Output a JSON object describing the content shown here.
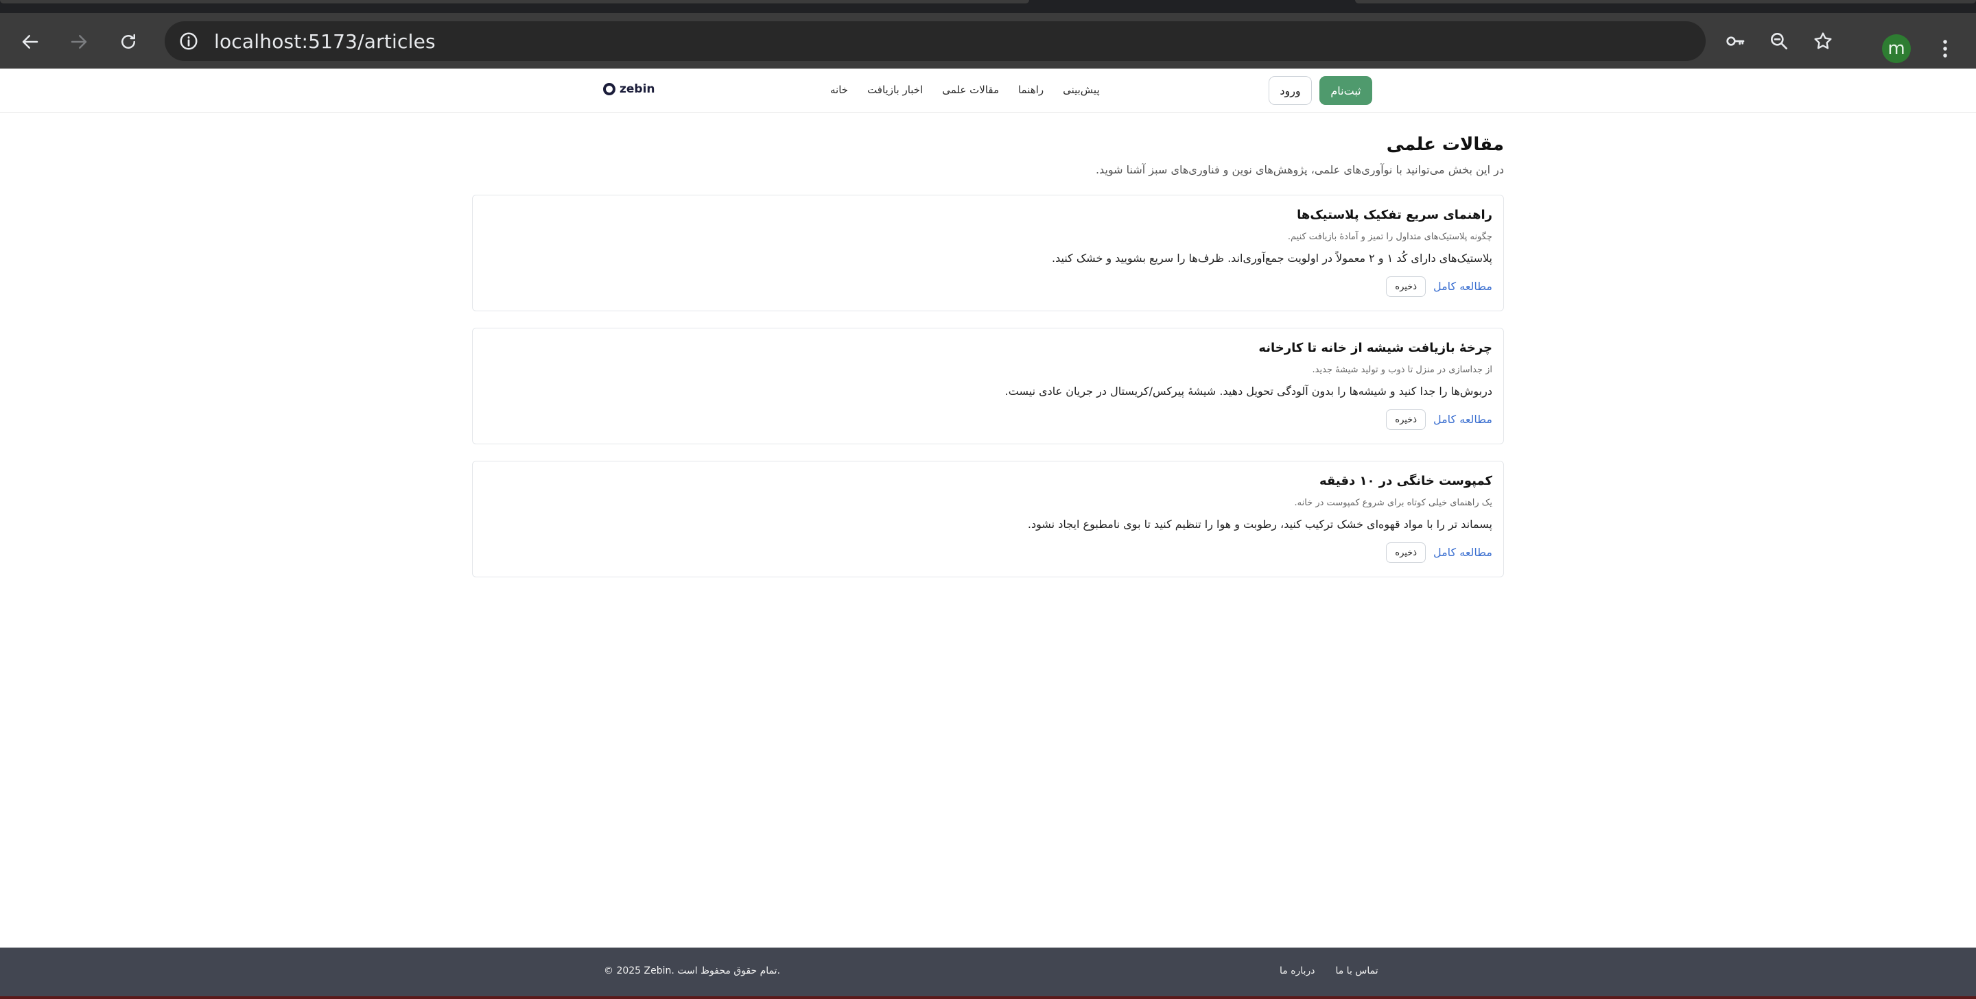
{
  "browser": {
    "url": "localhost:5173/articles",
    "icons": [
      "back-arrow-icon",
      "forward-arrow-icon",
      "reload-icon",
      "info-icon",
      "password-key-icon",
      "zoom-icon",
      "bookmark-star-icon",
      "menu-kebab-icon"
    ],
    "profile_initial": "m",
    "profile_color": "#2e7d32"
  },
  "header": {
    "logo_text": "zebin",
    "nav": [
      {
        "label": "خانه"
      },
      {
        "label": "اخبار بازیافت"
      },
      {
        "label": "مقالات علمی"
      },
      {
        "label": "راهنما"
      },
      {
        "label": "پیش‌بینی"
      }
    ],
    "signup_label": "ثبت‌نام",
    "login_label": "ورود",
    "accent_color": "#4f9a6d"
  },
  "main": {
    "title": "مقالات علمی",
    "description": "در این بخش می‌توانید با نوآوری‌های علمی، پژوهش‌های نوین و فناوری‌های سبز آشنا شوید.",
    "articles": [
      {
        "title": "راهنمای سریع تفکیک پلاستیک‌ها",
        "subtitle": "چگونه پلاستیک‌های متداول را تمیز و آمادهٔ بازیافت کنیم.",
        "body": "پلاستیک‌های دارای کُد ۱ و ۲ معمولاً در اولویت جمع‌آوری‌اند. ظرف‌ها را سریع بشویید و خشک کنید.",
        "read_label": "مطالعه کامل",
        "save_label": "ذخیره"
      },
      {
        "title": "چرخهٔ بازیافت شیشه از خانه تا کارخانه",
        "subtitle": "از جداسازی در منزل تا ذوب و تولید شیشهٔ جدید.",
        "body": "دربوش‌ها را جدا کنید و شیشه‌ها را بدون آلودگی تحویل دهید. شیشهٔ پیرکس/کریستال در جریان عادی نیست.",
        "read_label": "مطالعه کامل",
        "save_label": "ذخیره"
      },
      {
        "title": "کمپوست خانگی در ۱۰ دقیقه",
        "subtitle": "یک راهنمای خیلی کوتاه برای شروع کمپوست در خانه.",
        "body": "پسماند تر را با مواد قهوه‌ای خشک ترکیب کنید، رطوبت و هوا را تنظیم کنید تا بوی نامطبوع ایجاد نشود.",
        "read_label": "مطالعه کامل",
        "save_label": "ذخیره"
      }
    ]
  },
  "footer": {
    "copyright": "© 2025 Zebin. تمام حقوق محفوظ است.",
    "links": [
      {
        "label": "درباره ما"
      },
      {
        "label": "تماس با ما"
      }
    ]
  }
}
